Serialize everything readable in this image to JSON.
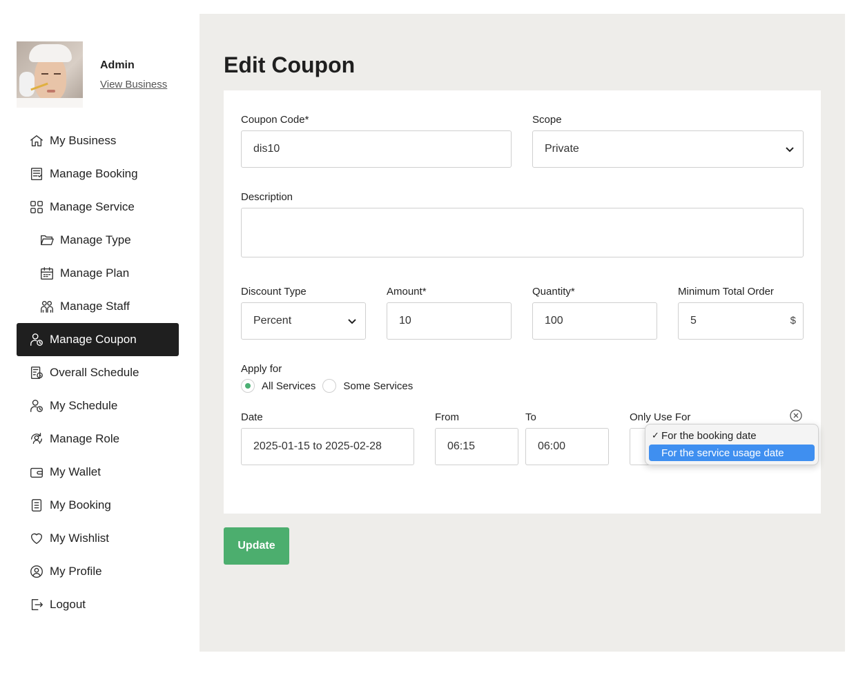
{
  "profile": {
    "name": "Admin",
    "view_business": "View Business"
  },
  "nav": [
    {
      "label": "My Business",
      "icon": "home-icon"
    },
    {
      "label": "Manage Booking",
      "icon": "booking-list-icon"
    },
    {
      "label": "Manage Service",
      "icon": "grid-icon"
    },
    {
      "label": "Manage Type",
      "icon": "folder-icon"
    },
    {
      "label": "Manage Plan",
      "icon": "calendar-icon"
    },
    {
      "label": "Manage Staff",
      "icon": "staff-icon"
    },
    {
      "label": "Manage Coupon",
      "icon": "user-clock-icon",
      "active": true
    },
    {
      "label": "Overall Schedule",
      "icon": "schedule-icon"
    },
    {
      "label": "My Schedule",
      "icon": "user-clock-icon"
    },
    {
      "label": "Manage Role",
      "icon": "role-icon"
    },
    {
      "label": "My Wallet",
      "icon": "wallet-icon"
    },
    {
      "label": "My Booking",
      "icon": "document-icon"
    },
    {
      "label": "My Wishlist",
      "icon": "heart-icon"
    },
    {
      "label": "My Profile",
      "icon": "user-circle-icon"
    },
    {
      "label": "Logout",
      "icon": "logout-icon"
    }
  ],
  "page": {
    "title": "Edit Coupon"
  },
  "form": {
    "coupon_code": {
      "label": "Coupon Code*",
      "value": "dis10"
    },
    "scope": {
      "label": "Scope",
      "value": "Private"
    },
    "description": {
      "label": "Description",
      "value": ""
    },
    "discount_type": {
      "label": "Discount Type",
      "value": "Percent"
    },
    "amount": {
      "label": "Amount*",
      "value": "10"
    },
    "quantity": {
      "label": "Quantity*",
      "value": "100"
    },
    "minimum_total_order": {
      "label": "Minimum Total Order",
      "value": "5",
      "suffix": "$"
    },
    "apply_for": {
      "label": "Apply for",
      "options": [
        "All Services",
        "Some Services"
      ],
      "selected": "All Services"
    },
    "date": {
      "label": "Date",
      "value": "2025-01-15 to 2025-02-28"
    },
    "from": {
      "label": "From",
      "value": "06:15"
    },
    "to": {
      "label": "To",
      "value": "06:00"
    },
    "only_use_for": {
      "label": "Only Use For",
      "options": [
        "For the booking date",
        "For the service usage date"
      ],
      "checked": "For the booking date",
      "highlighted": "For the service usage date"
    }
  },
  "actions": {
    "update": "Update"
  },
  "colors": {
    "accent_green": "#4cae6e",
    "active_nav_bg": "#1f1f1f",
    "main_bg": "#eeedea",
    "highlight_blue": "#3f8ff0"
  }
}
